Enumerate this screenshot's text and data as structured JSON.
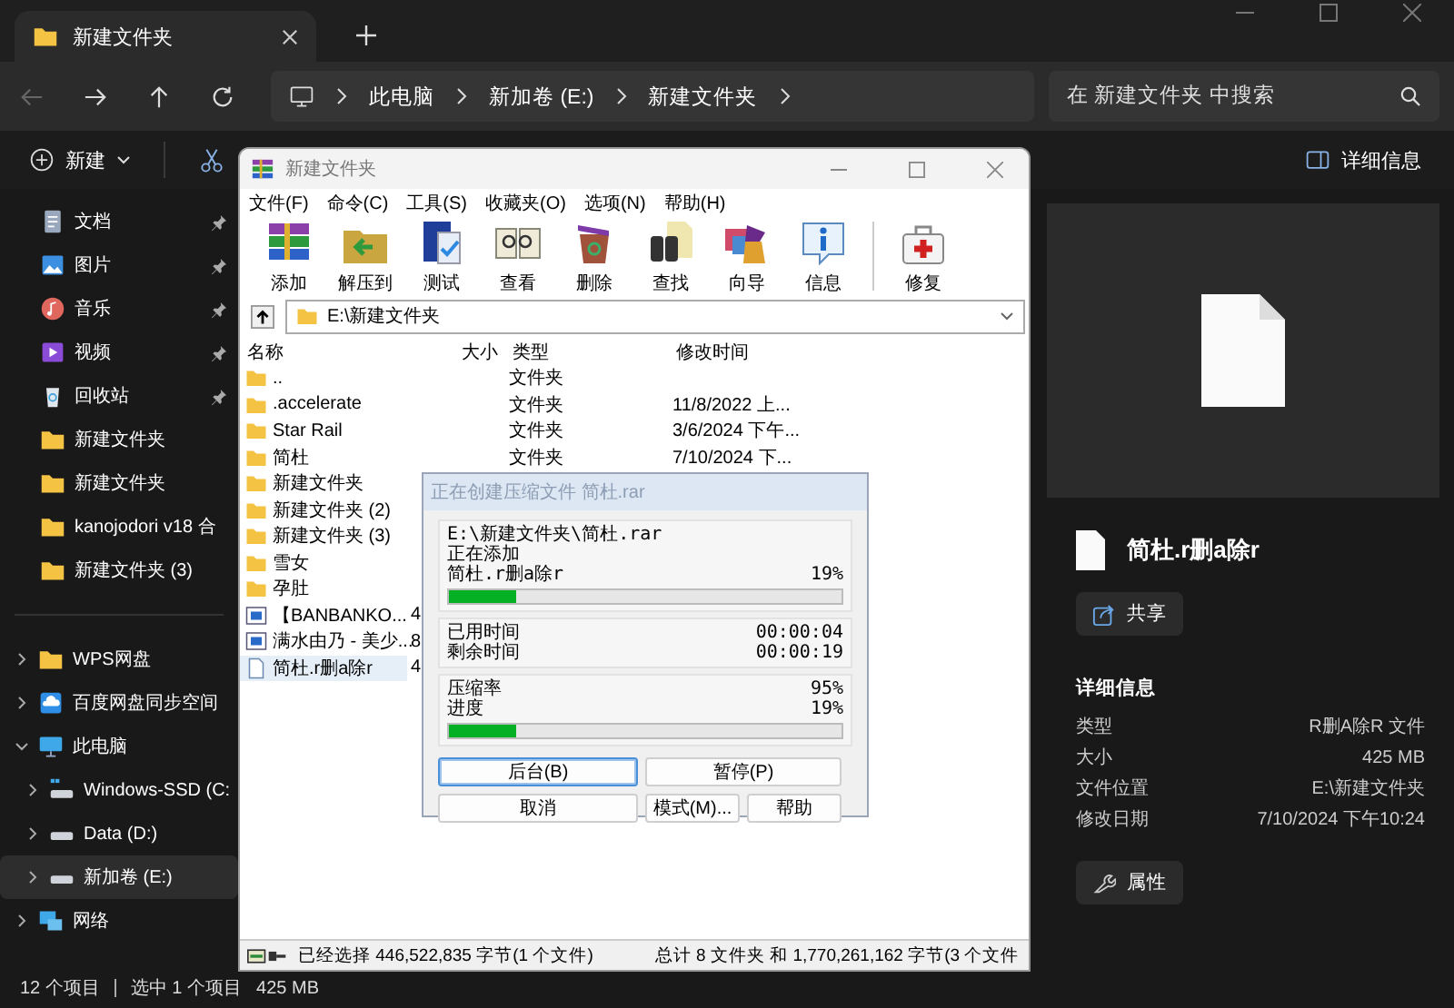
{
  "tab": {
    "title": "新建文件夹"
  },
  "breadcrumb": [
    "此电脑",
    "新加卷 (E:)",
    "新建文件夹"
  ],
  "search": {
    "placeholder": "在 新建文件夹 中搜索"
  },
  "command_bar": {
    "new_label": "新建",
    "details_label": "详细信息"
  },
  "sidebar": {
    "quick_access": [
      {
        "label": "文档",
        "kind": "document",
        "pinned": true
      },
      {
        "label": "图片",
        "kind": "picture",
        "pinned": true
      },
      {
        "label": "音乐",
        "kind": "music",
        "pinned": true
      },
      {
        "label": "视频",
        "kind": "video",
        "pinned": true
      },
      {
        "label": "回收站",
        "kind": "recycle",
        "pinned": true
      },
      {
        "label": "新建文件夹",
        "kind": "folder",
        "pinned": false
      },
      {
        "label": "新建文件夹",
        "kind": "folder",
        "pinned": false
      },
      {
        "label": "kanojodori v18 合",
        "kind": "folder",
        "pinned": false
      },
      {
        "label": "新建文件夹 (3)",
        "kind": "folder",
        "pinned": false
      }
    ],
    "tree": [
      {
        "label": "WPS网盘",
        "kind": "folder",
        "expanded": false,
        "selected": false
      },
      {
        "label": "百度网盘同步空间",
        "kind": "cloud",
        "expanded": false,
        "selected": false
      },
      {
        "label": "此电脑",
        "kind": "pc",
        "expanded": true,
        "selected": false,
        "children": [
          {
            "label": "Windows-SSD (C:",
            "kind": "system-drive",
            "expanded": false,
            "selected": false
          },
          {
            "label": "Data (D:)",
            "kind": "drive",
            "expanded": false,
            "selected": false
          },
          {
            "label": "新加卷 (E:)",
            "kind": "drive",
            "expanded": false,
            "selected": true
          }
        ]
      },
      {
        "label": "网络",
        "kind": "network",
        "expanded": false,
        "selected": false
      }
    ]
  },
  "details_pane": {
    "file_name": "简杜.r删a除r",
    "share_label": "共享",
    "heading": "详细信息",
    "properties": [
      {
        "key": "类型",
        "value": "R删A除R 文件"
      },
      {
        "key": "大小",
        "value": "425 MB"
      },
      {
        "key": "文件位置",
        "value": "E:\\新建文件夹"
      },
      {
        "key": "修改日期",
        "value": "7/10/2024 下午10:24"
      }
    ],
    "properties_label": "属性"
  },
  "status_bar": {
    "item_count": "12 个项目",
    "selection": "选中 1 个项目",
    "selection_size": "425 MB"
  },
  "winrar": {
    "title": "新建文件夹",
    "menu": [
      "文件(F)",
      "命令(C)",
      "工具(S)",
      "收藏夹(O)",
      "选项(N)",
      "帮助(H)"
    ],
    "toolbar": [
      {
        "label": "添加",
        "kind": "add",
        "separator_before": false
      },
      {
        "label": "解压到",
        "kind": "extract",
        "separator_before": false
      },
      {
        "label": "测试",
        "kind": "test",
        "separator_before": false
      },
      {
        "label": "查看",
        "kind": "view",
        "separator_before": false
      },
      {
        "label": "删除",
        "kind": "delete",
        "separator_before": false
      },
      {
        "label": "查找",
        "kind": "find",
        "separator_before": false
      },
      {
        "label": "向导",
        "kind": "wizard",
        "separator_before": false
      },
      {
        "label": "信息",
        "kind": "info",
        "separator_before": false
      },
      {
        "label": "修复",
        "kind": "repair",
        "separator_before": true
      }
    ],
    "path": "E:\\新建文件夹",
    "columns": [
      "名称",
      "大小",
      "类型",
      "修改时间"
    ],
    "files": [
      {
        "name": "..",
        "kind": "folder",
        "type": "文件夹",
        "selected": false
      },
      {
        "name": ".accelerate",
        "kind": "folder",
        "type": "文件夹",
        "modified": "11/8/2022 上...",
        "selected": false
      },
      {
        "name": "Star Rail",
        "kind": "folder",
        "type": "文件夹",
        "modified": "3/6/2024 下午...",
        "selected": false
      },
      {
        "name": "简杜",
        "kind": "folder",
        "type": "文件夹",
        "modified": "7/10/2024 下...",
        "selected": false
      },
      {
        "name": "新建文件夹",
        "kind": "folder",
        "selected": false
      },
      {
        "name": "新建文件夹 (2)",
        "kind": "folder",
        "selected": false
      },
      {
        "name": "新建文件夹 (3)",
        "kind": "folder",
        "selected": false
      },
      {
        "name": "雪女",
        "kind": "folder",
        "selected": false
      },
      {
        "name": "孕肚",
        "kind": "folder",
        "selected": false
      },
      {
        "name": "【BANBANKO...",
        "kind": "video",
        "size": "4",
        "selected": false
      },
      {
        "name": "满水由乃 - 美少...",
        "kind": "video",
        "size": "8",
        "selected": false
      },
      {
        "name": "简杜.r删a除r",
        "kind": "file",
        "size": "4",
        "selected": true
      }
    ],
    "status_bar": {
      "selected": "已经选择 446,522,835 字节(1 个文件)",
      "total": "总计 8 文件夹 和 1,770,261,162 字节(3 个文件"
    }
  },
  "progress_dialog": {
    "title": "正在创建压缩文件 简杜.rar",
    "archive_path": "E:\\新建文件夹\\简杜.rar",
    "action": "正在添加",
    "current_file": "简杜.r删a除r",
    "current_percent": "19%",
    "current_progress": {
      "level": 0.17
    },
    "times": [
      {
        "label": "已用时间",
        "value": "00:00:04"
      },
      {
        "label": "剩余时间",
        "value": "00:00:19"
      }
    ],
    "stats": [
      {
        "label": "压缩率",
        "value": "95%"
      },
      {
        "label": "进度",
        "value": "19%"
      }
    ],
    "total_progress": {
      "level": 0.17
    },
    "buttons": [
      {
        "label": "后台(B)",
        "focused": true
      },
      {
        "label": "暂停(P)",
        "focused": false
      },
      {
        "label": "取消",
        "focused": false
      },
      {
        "label": "模式(M)...",
        "focused": false
      },
      {
        "label": "帮助",
        "focused": false
      }
    ]
  }
}
